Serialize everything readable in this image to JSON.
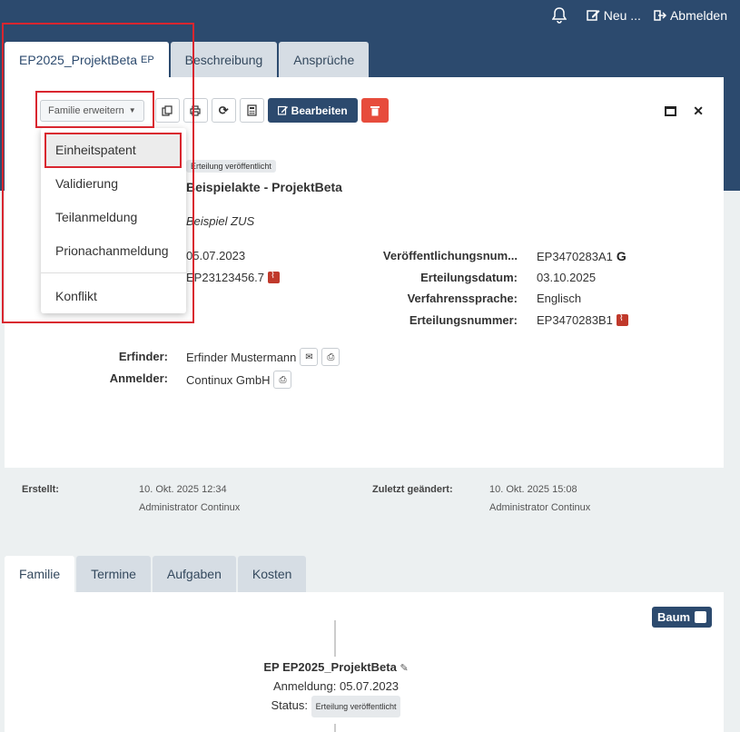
{
  "header": {
    "new_label": "Neu ...",
    "logout_label": "Abmelden"
  },
  "top_tabs": [
    {
      "label": "EP2025_ProjektBeta",
      "suffix": "EP"
    },
    {
      "label": "Beschreibung"
    },
    {
      "label": "Ansprüche"
    }
  ],
  "toolbar": {
    "family_extend_label": "Familie erweitern",
    "edit_label": "Bearbeiten"
  },
  "dropdown": {
    "items": [
      "Einheitspatent",
      "Validierung",
      "Teilanmeldung",
      "Prionachanmeldung"
    ],
    "extra": "Konflikt"
  },
  "record": {
    "status_badge": "Erteilung veröffentlicht",
    "title": "Beispielakte - ProjektBeta",
    "subtitle": "Beispiel ZUS",
    "filing_date": "05.07.2023",
    "app_number": "EP23123456.7",
    "pub_number_label": "Veröffentlichungsnum...",
    "pub_number": "EP3470283A1",
    "grant_date_label": "Erteilungsdatum:",
    "grant_date": "03.10.2025",
    "language_label": "Verfahrenssprache:",
    "language": "Englisch",
    "grant_number_label": "Erteilungsnummer:",
    "grant_number": "EP3470283B1",
    "inventor_label": "Erfinder:",
    "inventor": "Erfinder Mustermann",
    "applicant_label": "Anmelder:",
    "applicant": "Continux GmbH"
  },
  "meta": {
    "created_label": "Erstellt:",
    "created_date": "10. Okt. 2025 12:34",
    "created_by": "Administrator Continux",
    "modified_label": "Zuletzt geändert:",
    "modified_date": "10. Okt. 2025 15:08",
    "modified_by": "Administrator Continux"
  },
  "bottom_tabs": [
    "Familie",
    "Termine",
    "Aufgaben",
    "Kosten"
  ],
  "tree": {
    "toggle_label": "Baum",
    "node_title": "EP EP2025_ProjektBeta",
    "node_filing": "Anmeldung: 05.07.2023",
    "node_status_label": "Status:",
    "node_status": "Erteilung veröffentlicht"
  },
  "colors": {
    "primary": "#2c4a6e",
    "danger": "#e74c3c",
    "highlight": "#d9262f"
  }
}
